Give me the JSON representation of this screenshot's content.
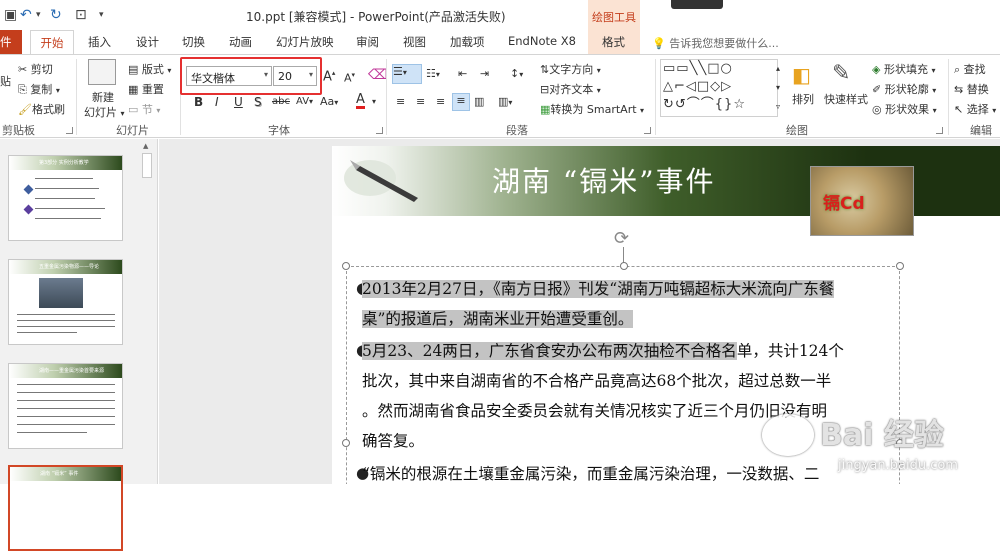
{
  "titlebar": {
    "doc_title": "10.ppt [兼容模式] - PowerPoint(产品激活失败)",
    "context_group": "绘图工具"
  },
  "tabs": {
    "file": "件",
    "home": "开始",
    "insert": "插入",
    "design": "设计",
    "transitions": "切换",
    "animations": "动画",
    "slideshow": "幻灯片放映",
    "review": "审阅",
    "view": "视图",
    "addins": "加载项",
    "endnote": "EndNote X8",
    "format": "格式",
    "tell_me": "告诉我您想要做什么..."
  },
  "ribbon": {
    "clipboard": {
      "cut": "剪切",
      "copy": "复制",
      "format_painter": "格式刷",
      "paste_partial": "贴",
      "label": "剪贴板"
    },
    "slides": {
      "new_slide_line1": "新建",
      "new_slide_line2": "幻灯片",
      "layout": "版式",
      "reset": "重置",
      "section": "节",
      "label": "幻灯片"
    },
    "font": {
      "font_name": "华文楷体",
      "font_size": "20",
      "bold": "B",
      "italic": "I",
      "underline": "U",
      "shadow": "S",
      "strike": "abc",
      "spacing": "AV",
      "case": "Aa",
      "grow": "A",
      "shrink": "A",
      "color": "A",
      "label": "字体"
    },
    "paragraph": {
      "text_direction": "文字方向",
      "align_text": "对齐文本",
      "smartart": "转换为 SmartArt",
      "label": "段落"
    },
    "drawing": {
      "arrange": "排列",
      "quick_styles": "快速样式",
      "shape_fill": "形状填充",
      "shape_outline": "形状轮廓",
      "shape_effects": "形状效果",
      "label": "绘图"
    },
    "editing": {
      "find": "查找",
      "replace": "替换",
      "select": "选择",
      "label": "编辑"
    }
  },
  "thumbnails": [
    {
      "num": "",
      "title": "第3部分  实例分析教学"
    },
    {
      "num": "",
      "title": "五重金属污染物源——导论"
    },
    {
      "num": "",
      "title": "湖南——重金属污染首要来源"
    },
    {
      "num": "",
      "title": "湖南 “镉米” 事件"
    }
  ],
  "slide": {
    "title": "湖南 “镉米”事件",
    "image_label": "镉Cd",
    "paragraphs": [
      {
        "line1_hl": "2013年2月27日，《南方日报》刊发“湖南万吨镉超标大米流向广东餐",
        "line2_hl": "桌”的报道后，湖南米业开始遭受重创。"
      },
      {
        "line1_hl": "5月23、24两日，广东省食安办公布两次抽检不合格名",
        "line1_rest": "单，共计124个",
        "line2": "批次，其中来自湖南省的不合格产品竟高达68个批次，超过总数一半",
        "line3": "。然而湖南省食品安全委员会就有关情况核实了近三个月仍旧没有明",
        "line4": "确答复。"
      },
      {
        "line1": "“镉米的根源在土壤重金属污染，而重金属污染治理，一没数据、二"
      }
    ]
  },
  "watermark": {
    "text": "Bai 经验",
    "url": "jingyan.baidu.com"
  },
  "colors": {
    "accent": "#c43e1c",
    "context_tab": "#fbe3d3",
    "highlight_box": "#e53030",
    "selection": "#c3c3c3"
  }
}
